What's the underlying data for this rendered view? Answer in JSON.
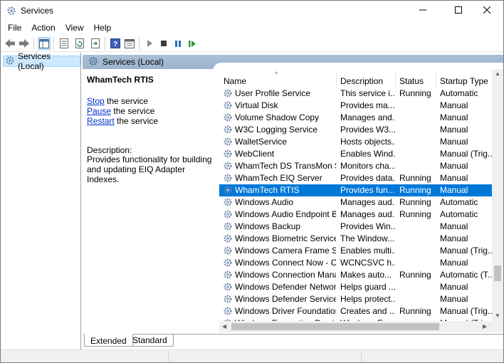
{
  "window": {
    "title": "Services"
  },
  "menu": [
    "File",
    "Action",
    "View",
    "Help"
  ],
  "toolbar": [
    "back-icon",
    "forward-icon",
    "show-hide-tree-icon",
    "properties-icon",
    "refresh-icon",
    "export-list-icon",
    "help-icon",
    "console-icon",
    "start-service-icon",
    "stop-service-icon",
    "pause-service-icon",
    "restart-service-icon"
  ],
  "tree": {
    "item": "Services (Local)"
  },
  "pane": {
    "header": "Services (Local)"
  },
  "extended": {
    "service_name": "WhamTech RTIS",
    "stop_link": "Stop",
    "stop_rest": " the service",
    "pause_link": "Pause",
    "pause_rest": " the service",
    "restart_link": "Restart",
    "restart_rest": " the service",
    "description_label": "Description:",
    "description": "Provides functionality for building and updating EIQ Adapter Indexes."
  },
  "columns": {
    "name": "Name",
    "description": "Description",
    "status": "Status",
    "startup": "Startup Type"
  },
  "rows": [
    {
      "name": "User Profile Service",
      "desc": "This service i...",
      "status": "Running",
      "startup": "Automatic"
    },
    {
      "name": "Virtual Disk",
      "desc": "Provides ma...",
      "status": "",
      "startup": "Manual"
    },
    {
      "name": "Volume Shadow Copy",
      "desc": "Manages and...",
      "status": "",
      "startup": "Manual"
    },
    {
      "name": "W3C Logging Service",
      "desc": "Provides W3...",
      "status": "",
      "startup": "Manual"
    },
    {
      "name": "WalletService",
      "desc": "Hosts objects...",
      "status": "",
      "startup": "Manual"
    },
    {
      "name": "WebClient",
      "desc": "Enables Wind...",
      "status": "",
      "startup": "Manual (Trig..."
    },
    {
      "name": "WhamTech DS TransMon S...",
      "desc": "Monitors cha...",
      "status": "",
      "startup": "Manual"
    },
    {
      "name": "WhamTech EIQ Server",
      "desc": "Provides data...",
      "status": "Running",
      "startup": "Manual"
    },
    {
      "name": "WhamTech RTIS",
      "desc": "Provides fun...",
      "status": "Running",
      "startup": "Manual",
      "selected": true
    },
    {
      "name": "Windows Audio",
      "desc": "Manages aud...",
      "status": "Running",
      "startup": "Automatic"
    },
    {
      "name": "Windows Audio Endpoint B...",
      "desc": "Manages aud...",
      "status": "Running",
      "startup": "Automatic"
    },
    {
      "name": "Windows Backup",
      "desc": "Provides Win...",
      "status": "",
      "startup": "Manual"
    },
    {
      "name": "Windows Biometric Service",
      "desc": "The Window...",
      "status": "",
      "startup": "Manual"
    },
    {
      "name": "Windows Camera Frame Se...",
      "desc": "Enables multi...",
      "status": "",
      "startup": "Manual (Trig..."
    },
    {
      "name": "Windows Connect Now - C...",
      "desc": "WCNCSVC h...",
      "status": "",
      "startup": "Manual"
    },
    {
      "name": "Windows Connection Mana...",
      "desc": "Makes auto...",
      "status": "Running",
      "startup": "Automatic (T..."
    },
    {
      "name": "Windows Defender Networ...",
      "desc": "Helps guard ...",
      "status": "",
      "startup": "Manual"
    },
    {
      "name": "Windows Defender Service",
      "desc": "Helps protect...",
      "status": "",
      "startup": "Manual"
    },
    {
      "name": "Windows Driver Foundation...",
      "desc": "Creates and ...",
      "status": "Running",
      "startup": "Manual (Trig..."
    },
    {
      "name": "Windows Encryption Provid...",
      "desc": "Windows Enc...",
      "status": "",
      "startup": "Manual (Trig..."
    }
  ],
  "tabs": [
    "Extended",
    "Standard"
  ],
  "colors": {
    "selection": "#0078d7",
    "header_band": "#a9bfd6",
    "link": "#0033cc"
  }
}
